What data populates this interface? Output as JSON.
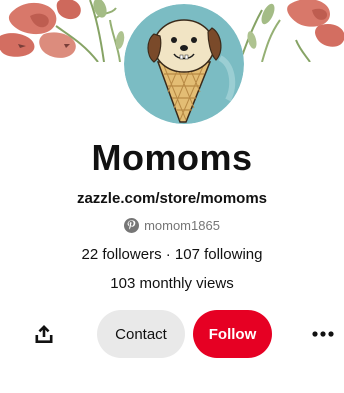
{
  "profile": {
    "name": "Momoms",
    "website": "zazzle.com/store/momoms",
    "handle": "momom1865",
    "stats": "22 followers · 107 following",
    "monthly_views": "103 monthly views"
  },
  "actions": {
    "contact_label": "Contact",
    "follow_label": "Follow"
  },
  "icons": {
    "share": "share-icon",
    "more": "more-icon",
    "pinterest": "pinterest-logo-icon"
  },
  "colors": {
    "follow_button": "#e60023",
    "contact_button": "#e9e9e9",
    "muted_text": "#767676",
    "avatar_background": "#7bbcc3"
  }
}
